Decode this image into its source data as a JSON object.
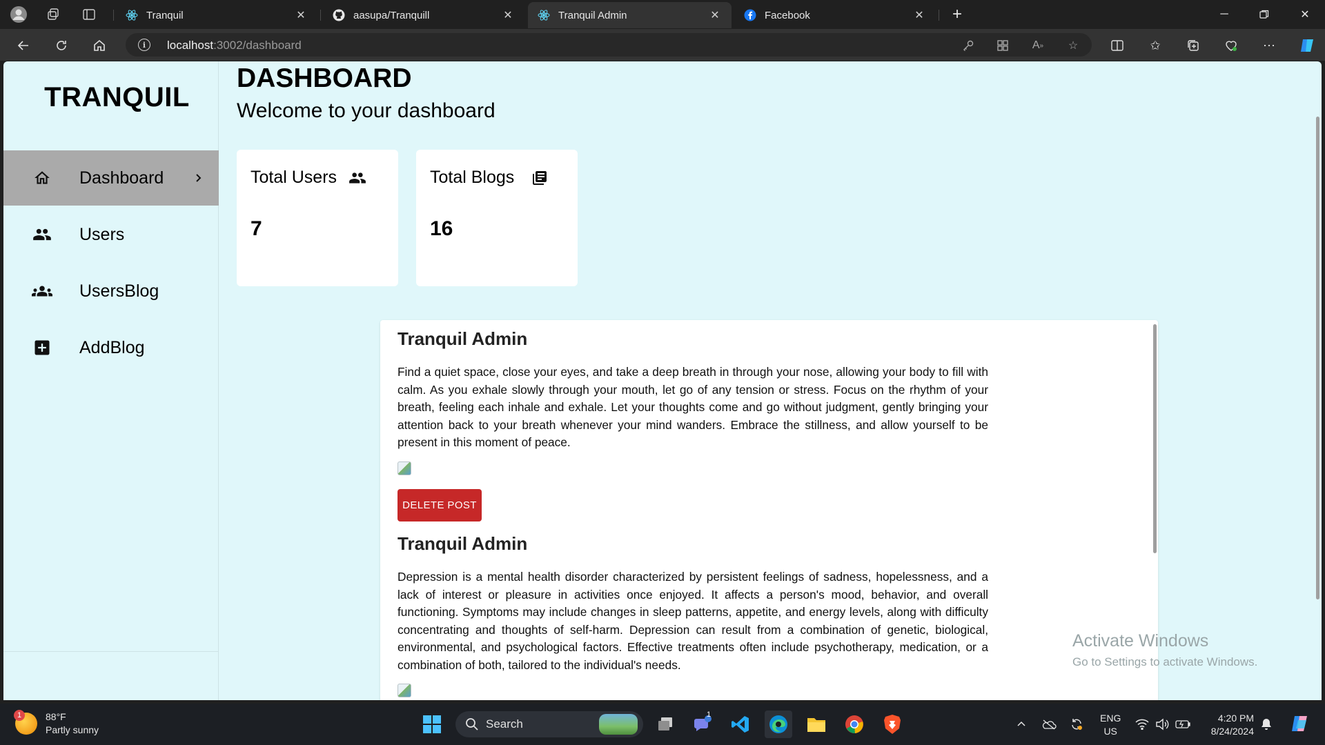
{
  "browser": {
    "tabs": [
      {
        "title": "Tranquil",
        "icon": "react-icon",
        "active": false
      },
      {
        "title": "aasupa/Tranquill",
        "icon": "github-icon",
        "active": false
      },
      {
        "title": "Tranquil Admin",
        "icon": "react-icon",
        "active": true
      },
      {
        "title": "Facebook",
        "icon": "facebook-icon",
        "active": false
      }
    ],
    "url_host": "localhost",
    "url_path": ":3002/dashboard"
  },
  "sidebar": {
    "brand": "TRANQUIL",
    "items": [
      {
        "label": "Dashboard",
        "icon": "home-icon",
        "active": true
      },
      {
        "label": "Users",
        "icon": "people-icon",
        "active": false
      },
      {
        "label": "UsersBlog",
        "icon": "groups-icon",
        "active": false
      },
      {
        "label": "AddBlog",
        "icon": "add-box-icon",
        "active": false
      }
    ]
  },
  "header": {
    "title": "DASHBOARD",
    "subtitle": "Welcome to your dashboard"
  },
  "stats": [
    {
      "label": "Total Users",
      "value": "7",
      "icon": "people-icon"
    },
    {
      "label": "Total Blogs",
      "value": "16",
      "icon": "library-books-icon"
    }
  ],
  "posts": [
    {
      "author": "Tranquil Admin",
      "body": "Find a quiet space, close your eyes, and take a deep breath in through your nose, allowing your body to fill with calm. As you exhale slowly through your mouth, let go of any tension or stress. Focus on the rhythm of your breath, feeling each inhale and exhale. Let your thoughts come and go without judgment, gently bringing your attention back to your breath whenever your mind wanders. Embrace the stillness, and allow yourself to be present in this moment of peace.",
      "delete_label": "DELETE POST"
    },
    {
      "author": "Tranquil Admin",
      "body": "Depression is a mental health disorder characterized by persistent feelings of sadness, hopelessness, and a lack of interest or pleasure in activities once enjoyed. It affects a person's mood, behavior, and overall functioning. Symptoms may include changes in sleep patterns, appetite, and energy levels, along with difficulty concentrating and thoughts of self-harm. Depression can result from a combination of genetic, biological, environmental, and psychological factors. Effective treatments often include psychotherapy, medication, or a combination of both, tailored to the individual's needs."
    }
  ],
  "watermark": {
    "line1": "Activate Windows",
    "line2": "Go to Settings to activate Windows."
  },
  "taskbar": {
    "weather_temp": "88°F",
    "weather_desc": "Partly sunny",
    "weather_badge": "1",
    "search_label": "Search",
    "teams_badge": "1",
    "lang_line1": "ENG",
    "lang_line2": "US",
    "time": "4:20 PM",
    "date": "8/24/2024"
  },
  "colors": {
    "page_bg": "#e0f7fa",
    "active_menu": "#aaaaaa",
    "delete_button": "#c62828"
  }
}
